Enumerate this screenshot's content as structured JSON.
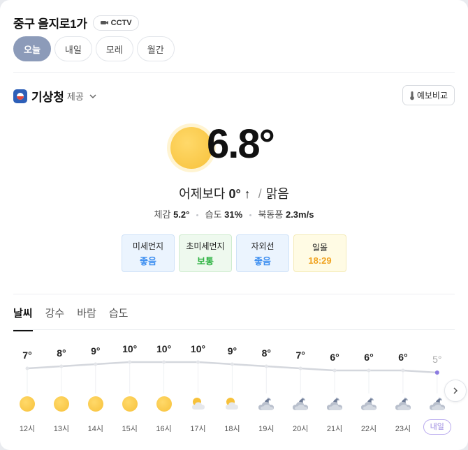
{
  "location": {
    "title": "중구 을지로1가",
    "cctv_label": "CCTV"
  },
  "day_tabs": [
    {
      "label": "오늘",
      "active": true
    },
    {
      "label": "내일",
      "active": false
    },
    {
      "label": "모레",
      "active": false
    },
    {
      "label": "월간",
      "active": false
    }
  ],
  "provider": {
    "name": "기상청",
    "suffix": "제공",
    "compare_label": "예보비교"
  },
  "current": {
    "temperature": "6.8°",
    "compare_text": "어제보다",
    "compare_value": "0° ↑",
    "condition": "맑음",
    "feels_label": "체감",
    "feels_value": "5.2°",
    "humidity_label": "습도",
    "humidity_value": "31%",
    "wind_label": "북동풍",
    "wind_value": "2.3m/s"
  },
  "air_quality": [
    {
      "label": "미세먼지",
      "value": "좋음",
      "tone": "blue"
    },
    {
      "label": "초미세먼지",
      "value": "보통",
      "tone": "green"
    },
    {
      "label": "자외선",
      "value": "좋음",
      "tone": "blue"
    },
    {
      "label": "일몰",
      "value": "18:29",
      "tone": "yellow"
    }
  ],
  "sub_tabs": [
    {
      "label": "날씨",
      "active": true
    },
    {
      "label": "강수",
      "active": false
    },
    {
      "label": "바람",
      "active": false
    },
    {
      "label": "습도",
      "active": false
    }
  ],
  "hourly": [
    {
      "time": "12시",
      "temp": "7°",
      "value": 7,
      "icon": "sun-icon"
    },
    {
      "time": "13시",
      "temp": "8°",
      "value": 8,
      "icon": "sun-icon"
    },
    {
      "time": "14시",
      "temp": "9°",
      "value": 9,
      "icon": "sun-icon"
    },
    {
      "time": "15시",
      "temp": "10°",
      "value": 10,
      "icon": "sun-icon"
    },
    {
      "time": "16시",
      "temp": "10°",
      "value": 10,
      "icon": "sun-icon"
    },
    {
      "time": "17시",
      "temp": "10°",
      "value": 10,
      "icon": "partly-cloudy-icon"
    },
    {
      "time": "18시",
      "temp": "9°",
      "value": 9,
      "icon": "partly-cloudy-icon"
    },
    {
      "time": "19시",
      "temp": "8°",
      "value": 8,
      "icon": "cloudy-night-icon"
    },
    {
      "time": "20시",
      "temp": "7°",
      "value": 7,
      "icon": "cloudy-night-icon"
    },
    {
      "time": "21시",
      "temp": "6°",
      "value": 6,
      "icon": "cloudy-night-icon"
    },
    {
      "time": "22시",
      "temp": "6°",
      "value": 6,
      "icon": "cloudy-night-icon"
    },
    {
      "time": "23시",
      "temp": "6°",
      "value": 6,
      "icon": "cloudy-night-icon"
    },
    {
      "time": "내일",
      "temp": "5°",
      "value": 5,
      "icon": "cloudy-night-icon",
      "tomorrow": true
    }
  ],
  "colors": {
    "accent": "#8c9bb9",
    "line": "#d4d7dd",
    "tomorrow_accent": "#8b7be0"
  }
}
